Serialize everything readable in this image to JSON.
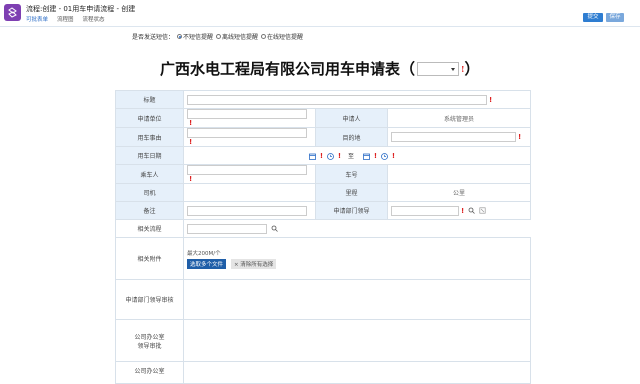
{
  "header": {
    "title": "流程:创建 - 01用车申请流程 - 创建",
    "tabs": [
      "可批表单",
      "流程图",
      "流程状态"
    ],
    "submit_label": "提交",
    "save_label": "保存"
  },
  "sms": {
    "label": "是否发送短信：",
    "options": [
      "不短信提醒",
      "离线短信提醒",
      "在线短信提醒"
    ]
  },
  "form_title": {
    "text": "广西水电工程局有限公司用车申请表（",
    "close": "）",
    "required_mark": "!"
  },
  "form": {
    "title_label": "标题",
    "apply_unit_label": "申请单位",
    "applicant_label": "申请人",
    "applicant_value": "系统管理员",
    "reason_label": "用车事由",
    "destination_label": "目的地",
    "date_label": "用车日期",
    "date_to": "至",
    "rider_label": "乘车人",
    "car_no_label": "车号",
    "driver_label": "司机",
    "mileage_label": "里程",
    "mileage_unit": "公里",
    "remark_label": "备注",
    "dept_leader_label": "申请部门领导",
    "related_process_label": "相关流程",
    "attachment_label": "相关附件",
    "attachment_hint": "最大200M/个",
    "select_files": "选取多个文件",
    "clear_selection": "× 清除所有选择",
    "dept_review_label": "申请部门领导审核",
    "office_review_label_1": "公司办公室",
    "office_review_label_2": "领导审批",
    "office_label_last": "公司办公室"
  }
}
